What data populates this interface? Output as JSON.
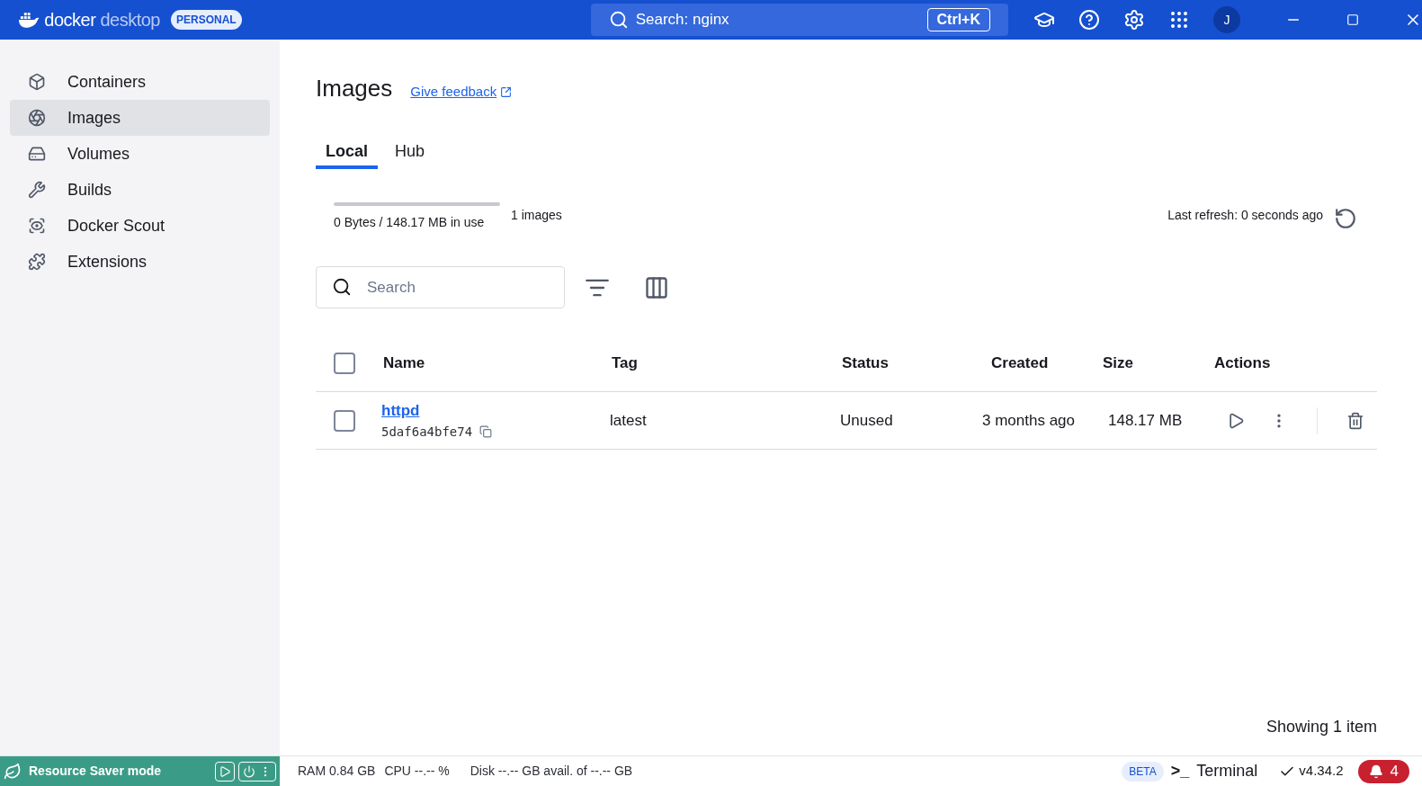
{
  "app": {
    "brand_bold": "docker",
    "brand_light": "desktop",
    "plan": "PERSONAL",
    "search": "Search: nginx",
    "shortcut": "Ctrl+K",
    "avatar": "J"
  },
  "sidebar": {
    "items": [
      {
        "label": "Containers",
        "selected": false
      },
      {
        "label": "Images",
        "selected": true
      },
      {
        "label": "Volumes",
        "selected": false
      },
      {
        "label": "Builds",
        "selected": false
      },
      {
        "label": "Docker Scout",
        "selected": false
      },
      {
        "label": "Extensions",
        "selected": false
      }
    ]
  },
  "page": {
    "title": "Images",
    "feedback": "Give feedback",
    "tabs": [
      {
        "label": "Local",
        "selected": true
      },
      {
        "label": "Hub",
        "selected": false
      }
    ],
    "usage": {
      "text": "0 Bytes / 148.17 MB in use",
      "count": "1 images"
    },
    "last_refresh": "Last refresh: 0 seconds ago",
    "search": {
      "placeholder": "Search"
    },
    "table": {
      "select_all": {
        "checked": false
      },
      "columns": [
        "Name",
        "Tag",
        "Status",
        "Created",
        "Size",
        "Actions"
      ],
      "rows": [
        {
          "checked": false,
          "name": "httpd",
          "id": "5daf6a4bfe74",
          "tag": "latest",
          "status": "Unused",
          "created": "3 months ago",
          "size": "148.17 MB"
        }
      ]
    },
    "footer": "Showing 1 item"
  },
  "status_bar": {
    "resource_saver": "Resource Saver mode",
    "stats": [
      "RAM 0.84 GB",
      "CPU --.-- %",
      "Disk --.-- GB avail. of --.-- GB"
    ],
    "beta": "BETA",
    "terminal_prompt": ">_",
    "terminal": "Terminal",
    "version": "v4.34.2",
    "notifications": "4"
  }
}
